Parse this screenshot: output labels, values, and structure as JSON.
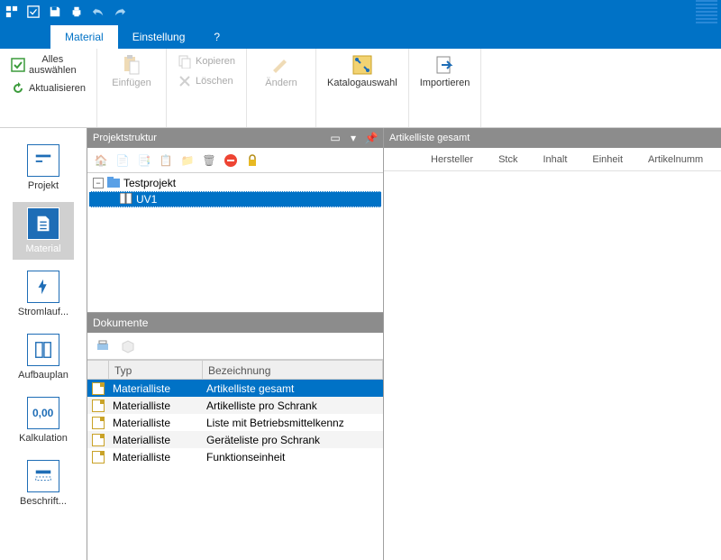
{
  "titlebar": {
    "icons": [
      "app",
      "checkbox",
      "save",
      "print",
      "undo",
      "redo"
    ]
  },
  "ribbonTabs": [
    {
      "label": "Material",
      "active": true
    },
    {
      "label": "Einstellung",
      "active": false
    },
    {
      "label": "?",
      "active": false
    }
  ],
  "ribbon": {
    "selectAll": "Alles\nauswählen",
    "refresh": "Aktualisieren",
    "paste": "Einfügen",
    "copy": "Kopieren",
    "delete": "Löschen",
    "edit": "Ändern",
    "catalog": "Katalogauswahl",
    "import": "Importieren"
  },
  "sidenav": [
    {
      "key": "projekt",
      "label": "Projekt"
    },
    {
      "key": "material",
      "label": "Material"
    },
    {
      "key": "stromlauf",
      "label": "Stromlauf..."
    },
    {
      "key": "aufbauplan",
      "label": "Aufbauplan"
    },
    {
      "key": "kalkulation",
      "label": "Kalkulation"
    },
    {
      "key": "beschrift",
      "label": "Beschrift..."
    }
  ],
  "projektstruktur": {
    "title": "Projektstruktur",
    "root": "Testprojekt",
    "child": "UV1"
  },
  "dokumente": {
    "title": "Dokumente",
    "columns": {
      "typ": "Typ",
      "bez": "Bezeichnung"
    },
    "rows": [
      {
        "typ": "Materialliste",
        "bez": "Artikelliste gesamt",
        "sel": true
      },
      {
        "typ": "Materialliste",
        "bez": "Artikelliste pro Schrank"
      },
      {
        "typ": "Materialliste",
        "bez": "Liste mit Betriebsmittelkennz"
      },
      {
        "typ": "Materialliste",
        "bez": "Geräteliste pro Schrank"
      },
      {
        "typ": "Materialliste",
        "bez": "Funktionseinheit"
      }
    ]
  },
  "rightPane": {
    "title": "Artikelliste gesamt",
    "columns": [
      "Hersteller",
      "Stck",
      "Inhalt",
      "Einheit",
      "Artikelnumm"
    ]
  }
}
